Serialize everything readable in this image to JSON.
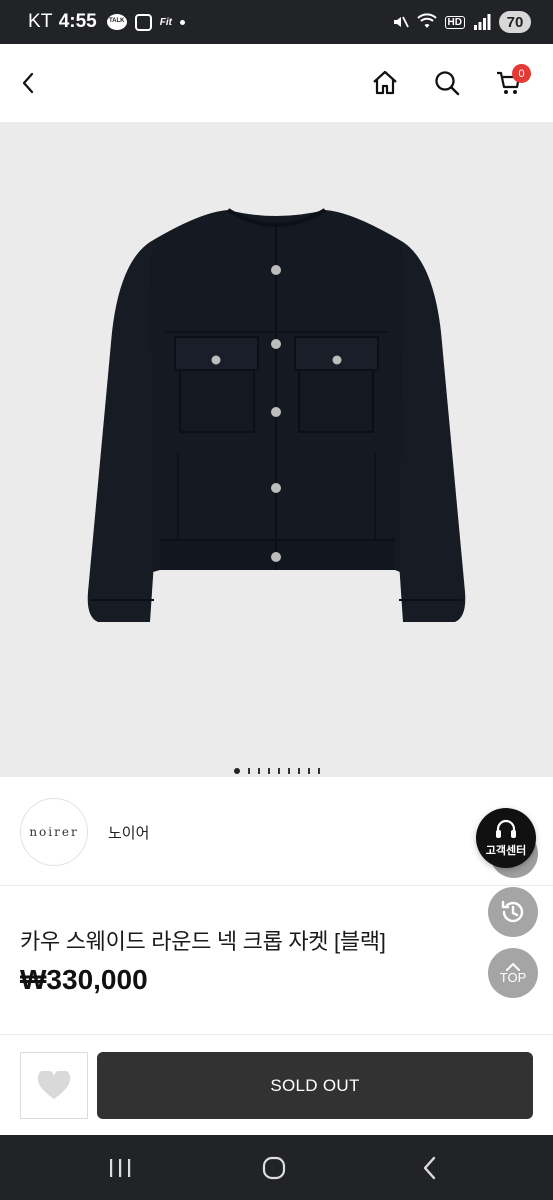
{
  "status_bar": {
    "carrier": "KT",
    "time": "4:55",
    "kakaotalk_badge": "TALK",
    "fit_label": "Fit",
    "hd_label": "HD",
    "battery": "70"
  },
  "header": {
    "cart_count": "0"
  },
  "gallery": {
    "total_images": 9,
    "active_index": 0
  },
  "brand": {
    "logo_text": "noirer",
    "name": "노이어"
  },
  "product": {
    "title": "카우 스웨이드 라운드 넥 크롭 자켓 [블랙]",
    "price": "₩330,000"
  },
  "floating": {
    "customer_center_label": "고객센터",
    "top_label": "TOP"
  },
  "actions": {
    "soldout_label": "SOLD OUT"
  },
  "colors": {
    "accent_badge": "#e53935",
    "button_dark": "#323232",
    "system_bar": "#222326"
  }
}
